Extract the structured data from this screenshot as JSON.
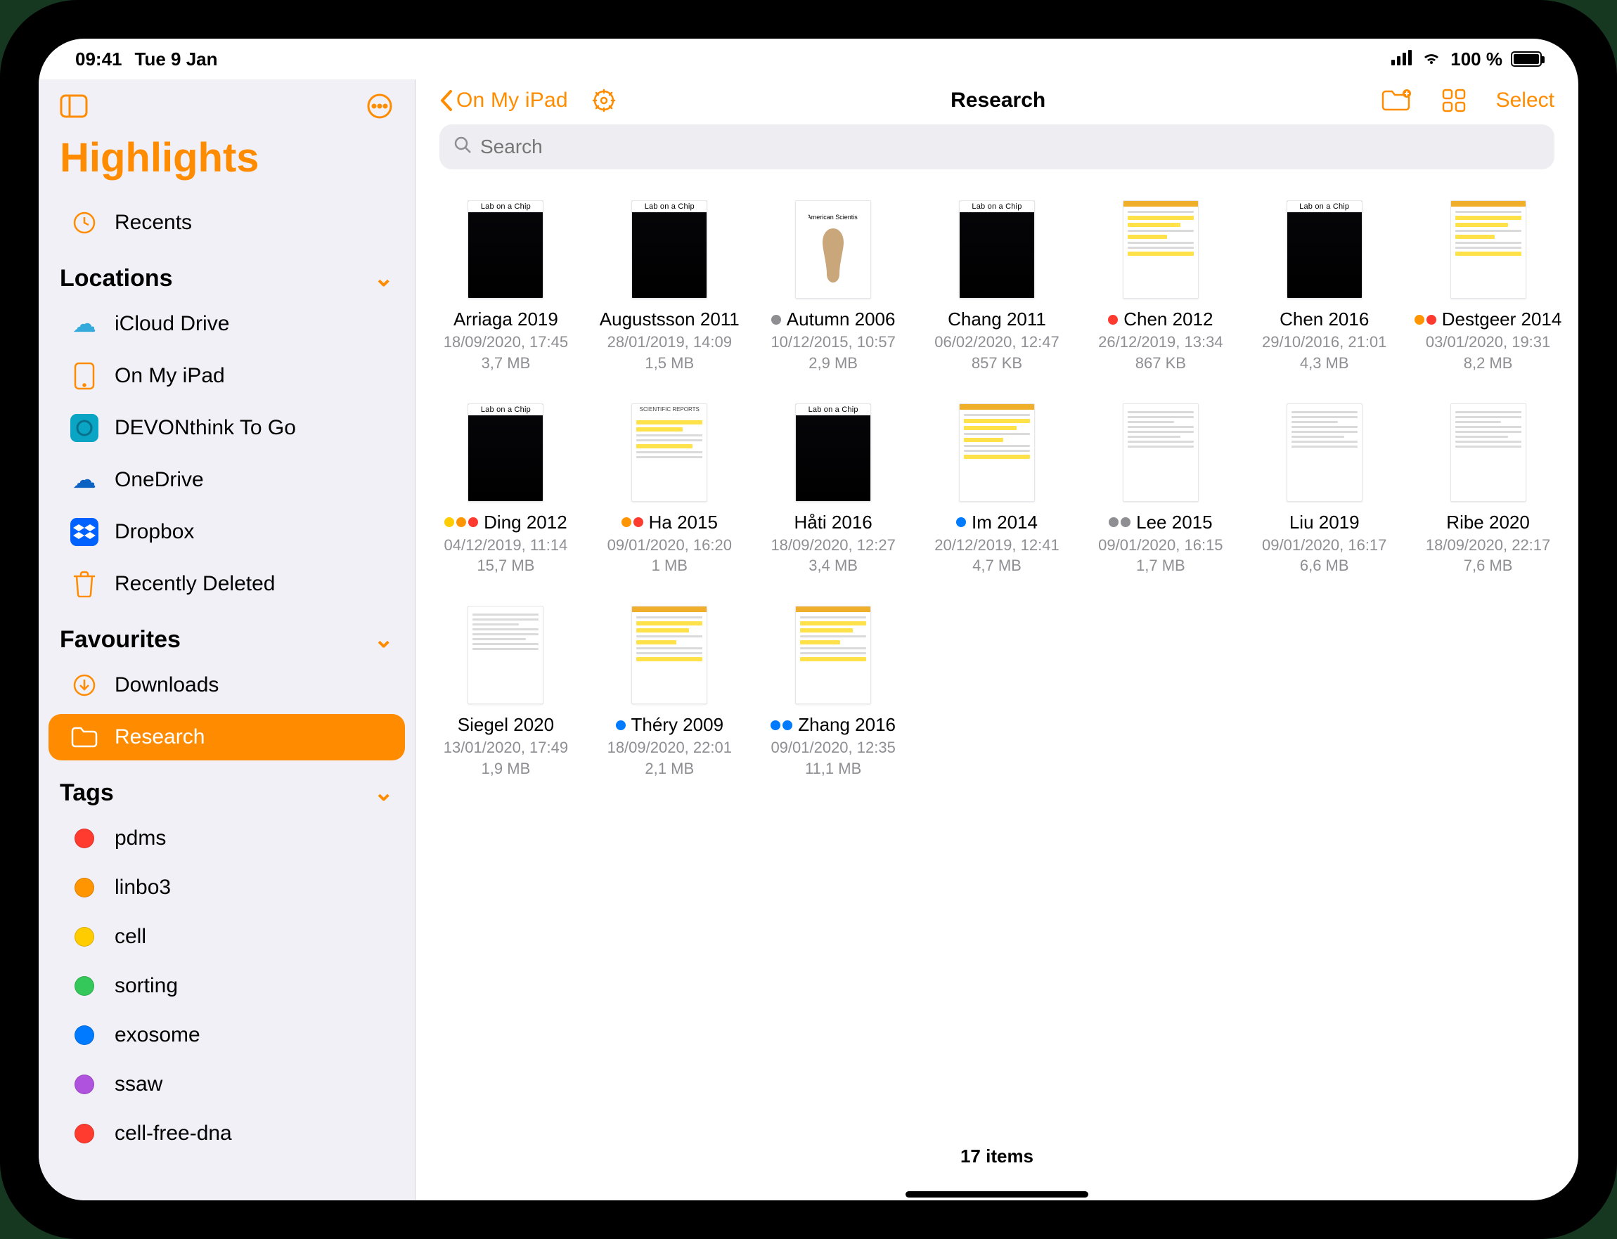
{
  "status": {
    "time": "09:41",
    "date": "Tue 9 Jan",
    "battery": "100 %"
  },
  "sidebar": {
    "app_name": "Highlights",
    "recents_label": "Recents",
    "locations_label": "Locations",
    "favourites_label": "Favourites",
    "tags_label": "Tags",
    "locations": [
      "iCloud Drive",
      "On My iPad",
      "DEVONthink To Go",
      "OneDrive",
      "Dropbox",
      "Recently Deleted"
    ],
    "favourites": [
      "Downloads",
      "Research"
    ],
    "active_favourite": "Research",
    "tags": [
      {
        "label": "pdms",
        "color": "#ff3b30"
      },
      {
        "label": "linbo3",
        "color": "#ff9500"
      },
      {
        "label": "cell",
        "color": "#ffcc00"
      },
      {
        "label": "sorting",
        "color": "#34c759"
      },
      {
        "label": "exosome",
        "color": "#007aff"
      },
      {
        "label": "ssaw",
        "color": "#af52de"
      },
      {
        "label": "cell-free-dna",
        "color": "#ff3b30"
      }
    ]
  },
  "toolbar": {
    "back_label": "On My iPad",
    "title": "Research",
    "select_label": "Select"
  },
  "search": {
    "placeholder": "Search"
  },
  "files": [
    {
      "name": "Arriaga 2019",
      "date": "18/09/2020, 17:45",
      "size": "3,7 MB",
      "thumb": "lab",
      "dots": []
    },
    {
      "name": "Augustsson 2011",
      "date": "28/01/2019, 14:09",
      "size": "1,5 MB",
      "thumb": "lab",
      "dots": []
    },
    {
      "name": "Autumn 2006",
      "date": "10/12/2015, 10:57",
      "size": "2,9 MB",
      "thumb": "gecko",
      "dots": [
        "#8e8e93"
      ]
    },
    {
      "name": "Chang 2011",
      "date": "06/02/2020, 12:47",
      "size": "857 KB",
      "thumb": "lab",
      "dots": []
    },
    {
      "name": "Chen 2012",
      "date": "26/12/2019, 13:34",
      "size": "867 KB",
      "thumb": "hl",
      "dots": [
        "#ff3b30"
      ]
    },
    {
      "name": "Chen 2016",
      "date": "29/10/2016, 21:01",
      "size": "4,3 MB",
      "thumb": "lab",
      "dots": []
    },
    {
      "name": "Destgeer 2014",
      "date": "03/01/2020, 19:31",
      "size": "8,2 MB",
      "thumb": "hl",
      "dots": [
        "#ff9500",
        "#ff3b30"
      ]
    },
    {
      "name": "Ding 2012",
      "date": "04/12/2019, 11:14",
      "size": "15,7 MB",
      "thumb": "lab",
      "dots": [
        "#ffcc00",
        "#ff9500",
        "#ff3b30"
      ]
    },
    {
      "name": "Ha 2015",
      "date": "09/01/2020, 16:20",
      "size": "1 MB",
      "thumb": "rep",
      "dots": [
        "#ff9500",
        "#ff3b30"
      ]
    },
    {
      "name": "Håti 2016",
      "date": "18/09/2020, 12:27",
      "size": "3,4 MB",
      "thumb": "lab",
      "dots": []
    },
    {
      "name": "Im 2014",
      "date": "20/12/2019, 12:41",
      "size": "4,7 MB",
      "thumb": "hl",
      "dots": [
        "#007aff"
      ]
    },
    {
      "name": "Lee 2015",
      "date": "09/01/2020, 16:15",
      "size": "1,7 MB",
      "thumb": "doc",
      "dots": [
        "#8e8e93",
        "#8e8e93"
      ]
    },
    {
      "name": "Liu 2019",
      "date": "09/01/2020, 16:17",
      "size": "6,6 MB",
      "thumb": "doc",
      "dots": []
    },
    {
      "name": "Ribe 2020",
      "date": "18/09/2020, 22:17",
      "size": "7,6 MB",
      "thumb": "doc",
      "dots": []
    },
    {
      "name": "Siegel 2020",
      "date": "13/01/2020, 17:49",
      "size": "1,9 MB",
      "thumb": "doc",
      "dots": []
    },
    {
      "name": "Théry 2009",
      "date": "18/09/2020, 22:01",
      "size": "2,1 MB",
      "thumb": "hl",
      "dots": [
        "#007aff"
      ]
    },
    {
      "name": "Zhang 2016",
      "date": "09/01/2020, 12:35",
      "size": "11,1 MB",
      "thumb": "hl",
      "dots": [
        "#007aff",
        "#007aff"
      ]
    }
  ],
  "footer": {
    "count_label": "17 items"
  }
}
